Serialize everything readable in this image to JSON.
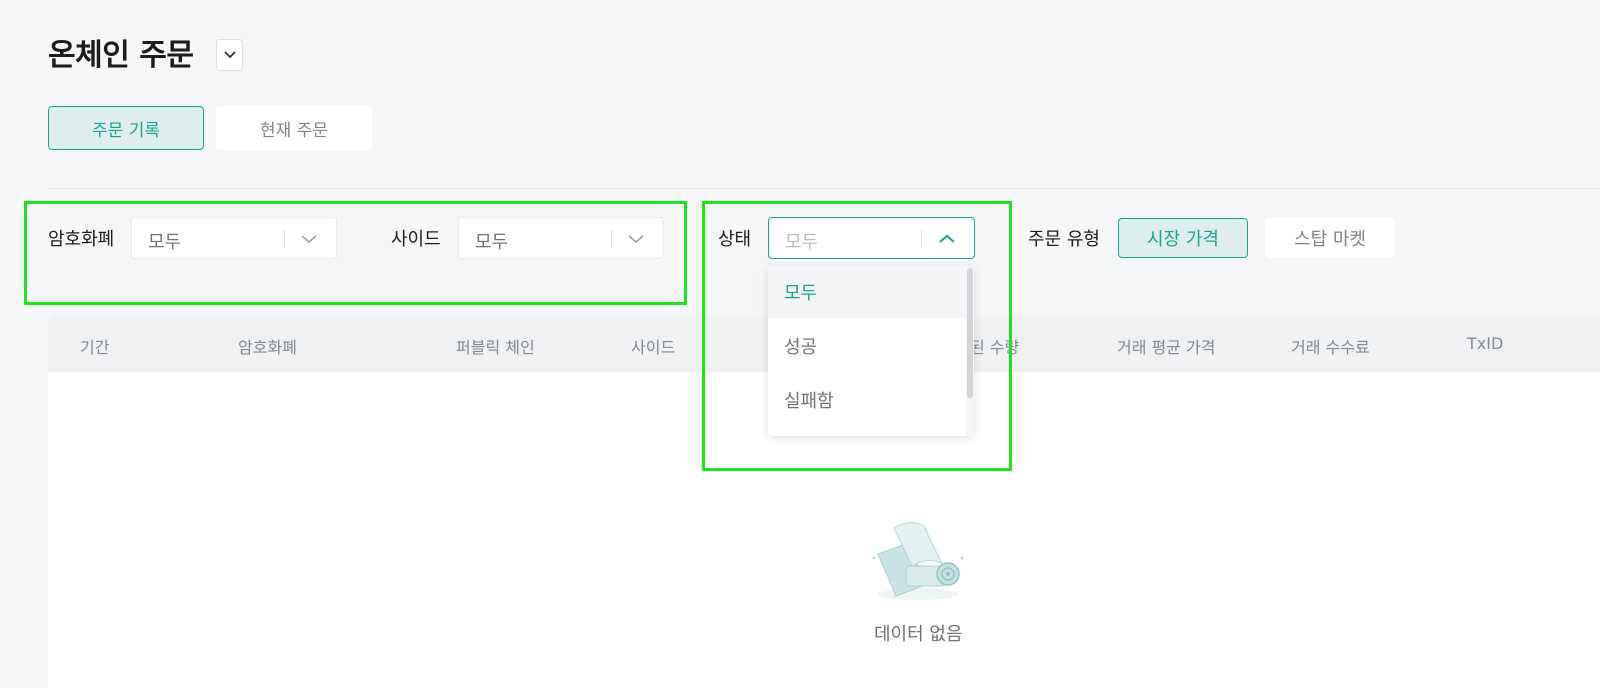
{
  "header": {
    "title": "온체인 주문"
  },
  "tabs": [
    {
      "label": "주문 기록",
      "active": true
    },
    {
      "label": "현재 주문",
      "active": false
    }
  ],
  "filters": {
    "crypto": {
      "label": "암호화폐",
      "value": "모두"
    },
    "side": {
      "label": "사이드",
      "value": "모두"
    },
    "status": {
      "label": "상태",
      "value": "모두",
      "open": true
    },
    "order_type": {
      "label": "주문 유형",
      "options": [
        {
          "label": "시장 가격",
          "active": true
        },
        {
          "label": "스탑 마켓",
          "active": false
        }
      ]
    }
  },
  "status_menu": {
    "items": [
      {
        "label": "모두",
        "selected": true
      },
      {
        "label": "성공",
        "selected": false
      },
      {
        "label": "실패함",
        "selected": false
      }
    ]
  },
  "table": {
    "columns": [
      "기간",
      "암호화폐",
      "퍼블릭 체인",
      "사이드",
      "된 수량",
      "거래 평균 가격",
      "거래 수수료",
      "TxID"
    ],
    "rows": [],
    "empty_text": "데이터 없음"
  },
  "colors": {
    "accent": "#15a58f",
    "highlight": "#1ee51a"
  }
}
